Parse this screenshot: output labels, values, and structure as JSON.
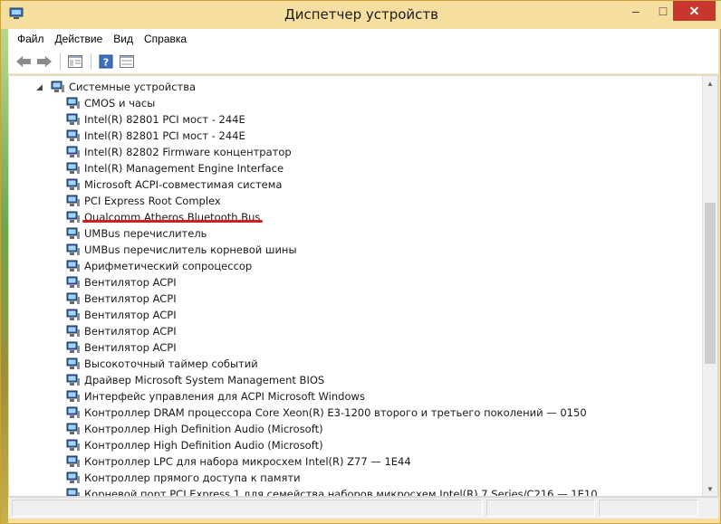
{
  "window": {
    "title": "Диспетчер устройств",
    "close_glyph": "✕",
    "maximize_glyph": "□",
    "minimize_glyph": "–",
    "accent_colors": {
      "frame": "#f6de9e",
      "close": "#c7372f",
      "highlight_underline": "#d21f1f"
    }
  },
  "menu": {
    "items": [
      {
        "label": "Файл"
      },
      {
        "label": "Действие"
      },
      {
        "label": "Вид"
      },
      {
        "label": "Справка"
      }
    ]
  },
  "toolbar": {
    "buttons": [
      {
        "icon": "back-arrow-icon"
      },
      {
        "icon": "forward-arrow-icon"
      },
      {
        "icon": "show-hide-tree-icon"
      },
      {
        "icon": "help-icon"
      },
      {
        "icon": "console-tree-icon"
      }
    ]
  },
  "tree": {
    "category": "Системные устройства",
    "highlighted_device": "Qualcomm Atheros Bluetooth Bus",
    "devices": [
      "CMOS и часы",
      "Intel(R) 82801 PCI мост - 244E",
      "Intel(R) 82801 PCI мост - 244E",
      "Intel(R) 82802 Firmware концентратор",
      "Intel(R) Management Engine Interface",
      "Microsoft ACPI-совместимая система",
      "PCI Express Root Complex",
      "Qualcomm Atheros Bluetooth Bus",
      "UMBus перечислитель",
      "UMBus перечислитель корневой шины",
      "Арифметический сопроцессор",
      "Вентилятор ACPI",
      "Вентилятор ACPI",
      "Вентилятор ACPI",
      "Вентилятор ACPI",
      "Вентилятор ACPI",
      "Высокоточный таймер событий",
      "Драйвер Microsoft System Management BIOS",
      "Интерфейс управления для ACPI Microsoft Windows",
      "Контроллер DRAM процессора Core Xeon(R) E3-1200 второго и третьего поколений — 0150",
      "Контроллер High Definition Audio (Microsoft)",
      "Контроллер High Definition Audio (Microsoft)",
      "Контроллер LPC для набора микросхем Intel(R) Z77 — 1E44",
      "Контроллер прямого доступа к памяти",
      "Корневой порт PCI Express 1 для семейства наборов микросхем Intel(R) 7 Series/C216 — 1E10"
    ]
  },
  "scrollbar": {
    "up_glyph": "▲",
    "down_glyph": "▼"
  }
}
